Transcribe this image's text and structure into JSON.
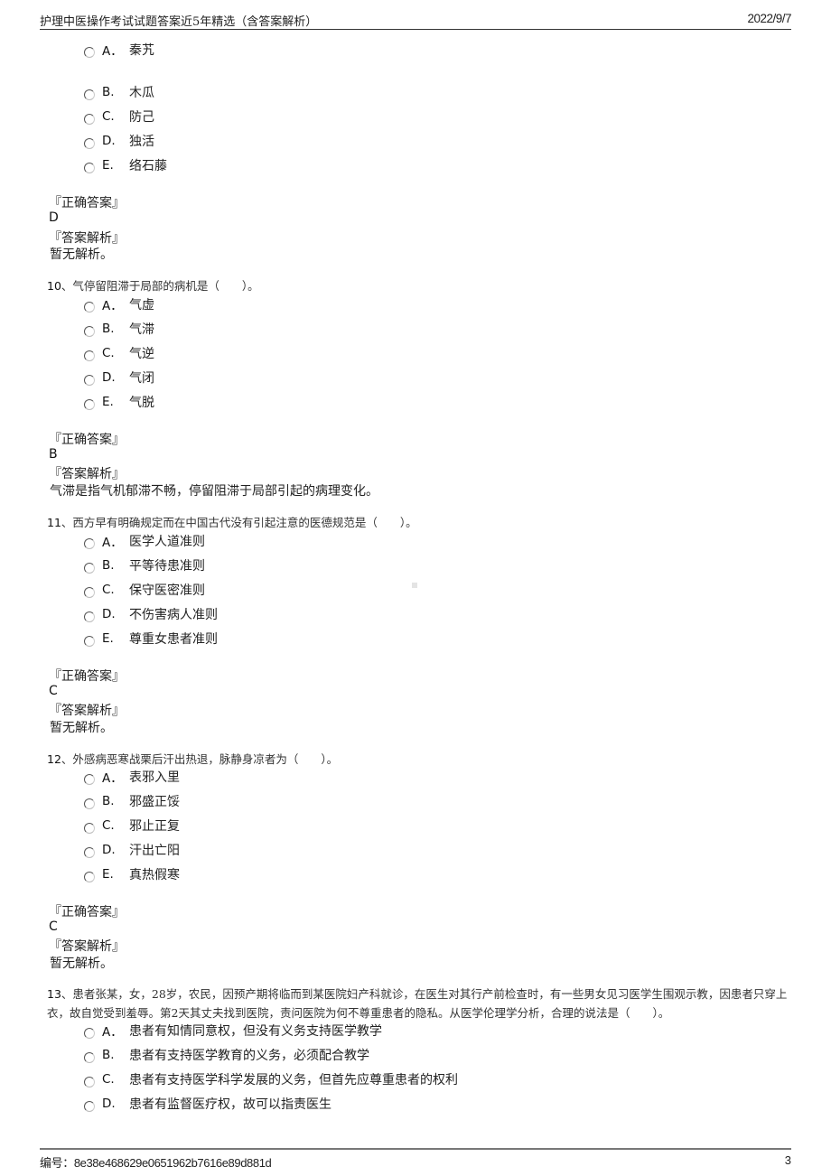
{
  "header": {
    "title": "护理中医操作考试试题答案近5年精选（含答案解析）",
    "date": "2022/9/7"
  },
  "footer": {
    "code_label": "编号：",
    "code": "8e38e468629e0651962b7616e89d881d",
    "page": "3"
  },
  "labels": {
    "correct_answer": "『正确答案』",
    "analysis": "『答案解析』"
  },
  "q9": {
    "options": [
      {
        "letter": "A．",
        "text": "秦艽"
      },
      {
        "letter": "B.",
        "text": "木瓜"
      },
      {
        "letter": "C.",
        "text": "防己"
      },
      {
        "letter": "D.",
        "text": "独活"
      },
      {
        "letter": "E.",
        "text": "络石藤"
      }
    ],
    "answer": "D",
    "analysis": "暂无解析。"
  },
  "q10": {
    "number": "10",
    "stem": "、气停留阻滞于局部的病机是（　　）。",
    "options": [
      {
        "letter": "A．",
        "text": "气虚"
      },
      {
        "letter": "B.",
        "text": "气滞"
      },
      {
        "letter": "C.",
        "text": "气逆"
      },
      {
        "letter": "D.",
        "text": "气闭"
      },
      {
        "letter": "E.",
        "text": "气脱"
      }
    ],
    "answer": "B",
    "analysis": "气滞是指气机郁滞不畅，停留阻滞于局部引起的病理变化。"
  },
  "q11": {
    "number": "11",
    "stem": "、西方早有明确规定而在中国古代没有引起注意的医德规范是（　　）。",
    "options": [
      {
        "letter": "A．",
        "text": "医学人道准则"
      },
      {
        "letter": "B.",
        "text": "平等待患准则"
      },
      {
        "letter": "C.",
        "text": "保守医密准则"
      },
      {
        "letter": "D.",
        "text": "不伤害病人准则"
      },
      {
        "letter": "E.",
        "text": "尊重女患者准则"
      }
    ],
    "answer": "C",
    "analysis": "暂无解析。"
  },
  "q12": {
    "number": "12",
    "stem": "、外感病恶寒战栗后汗出热退，脉静身凉者为（　　）。",
    "options": [
      {
        "letter": "A．",
        "text": "表邪入里"
      },
      {
        "letter": "B.",
        "text": "邪盛正馁"
      },
      {
        "letter": "C.",
        "text": "邪止正复"
      },
      {
        "letter": "D.",
        "text": "汗出亡阳"
      },
      {
        "letter": "E.",
        "text": "真热假寒"
      }
    ],
    "answer": "C",
    "analysis": "暂无解析。"
  },
  "q13": {
    "number": "13",
    "stem": "、患者张某，女，28岁，农民，因预产期将临而到某医院妇产科就诊，在医生对其行产前检查时，有一些男女见习医学生围观示教，因患者只穿上衣，故自觉受到羞辱。第2天其丈夫找到医院，责问医院为何不尊重患者的隐私。从医学伦理学分析，合理的说法是（　　）。",
    "options": [
      {
        "letter": "A．",
        "text": "患者有知情同意权，但没有义务支持医学教学"
      },
      {
        "letter": "B.",
        "text": "患者有支持医学教育的义务，必须配合教学"
      },
      {
        "letter": "C.",
        "text": "患者有支持医学科学发展的义务，但首先应尊重患者的权利"
      },
      {
        "letter": "D.",
        "text": "患者有监督医疗权，故可以指责医生"
      }
    ]
  }
}
